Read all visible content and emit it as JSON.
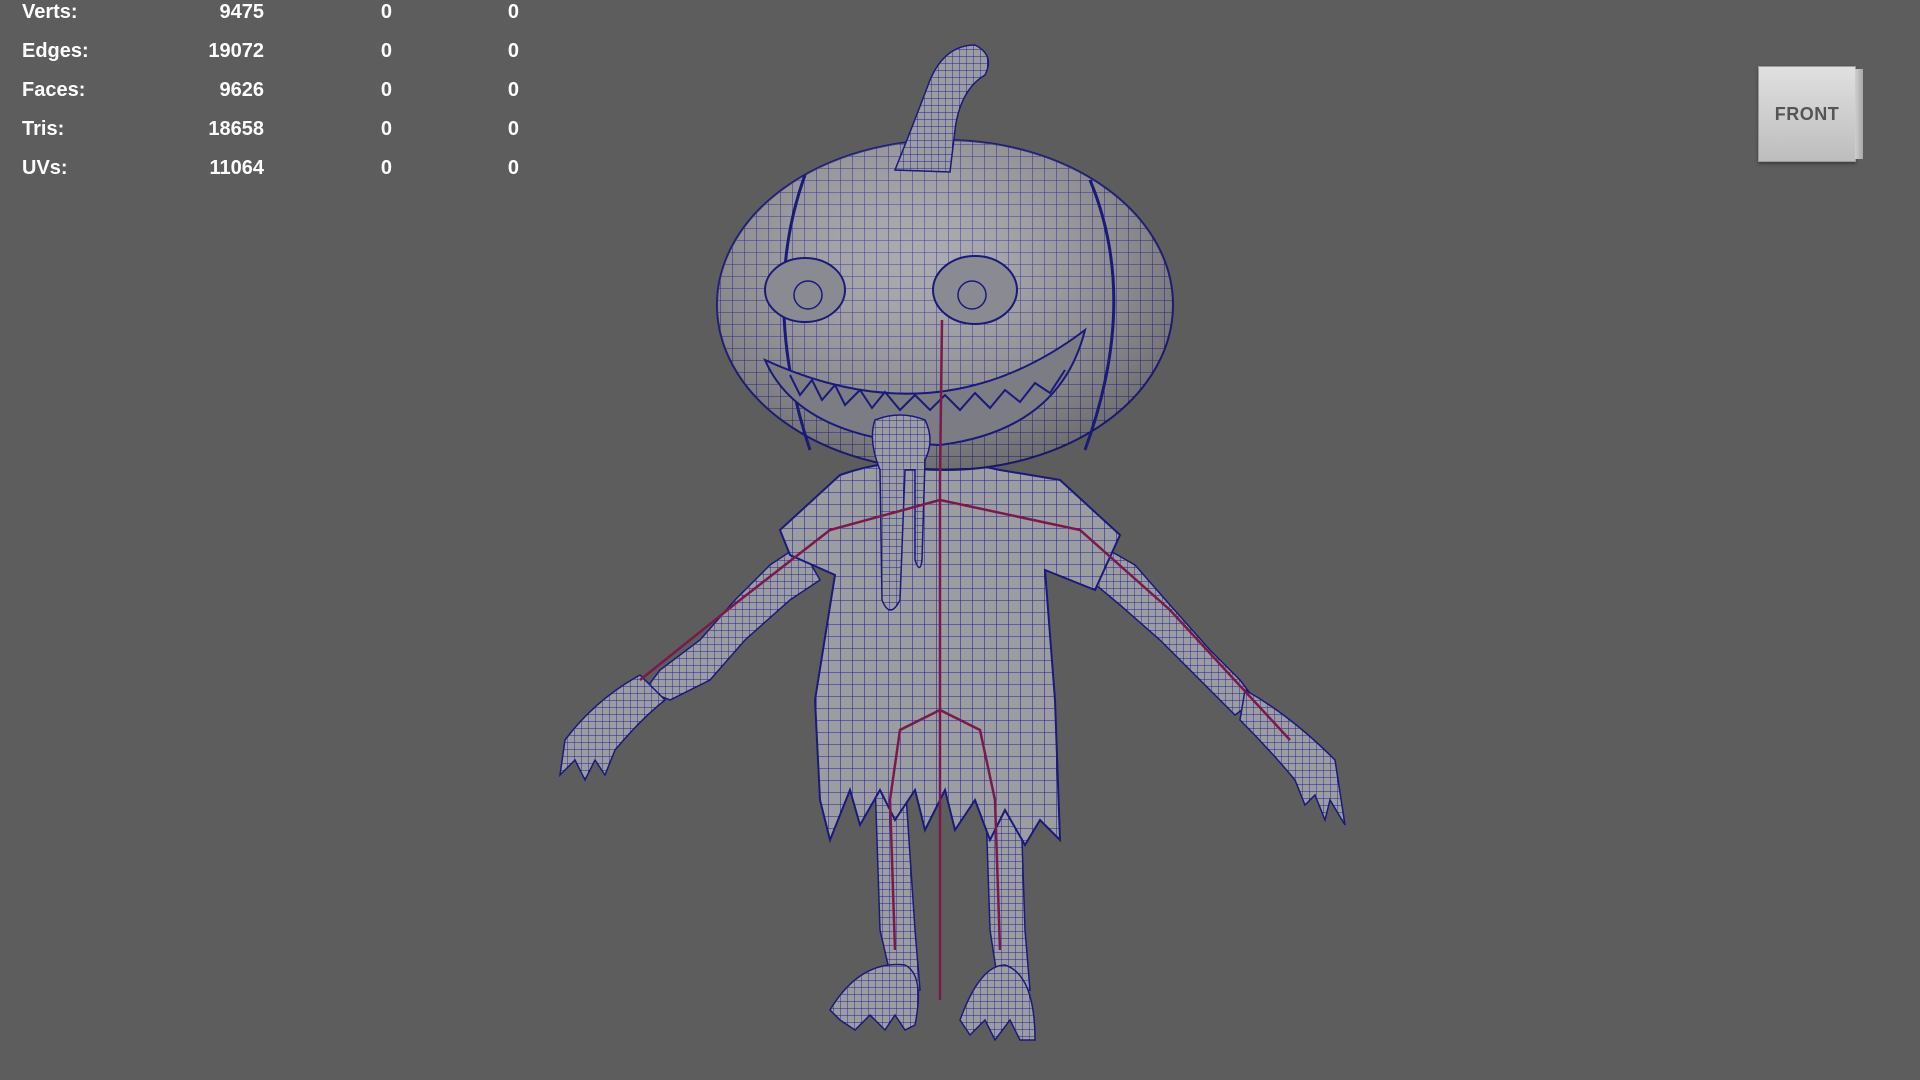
{
  "hud": {
    "rows": [
      {
        "label": "Verts:",
        "v1": "9475",
        "v2": "0",
        "v3": "0"
      },
      {
        "label": "Edges:",
        "v1": "19072",
        "v2": "0",
        "v3": "0"
      },
      {
        "label": "Faces:",
        "v1": "9626",
        "v2": "0",
        "v3": "0"
      },
      {
        "label": "Tris:",
        "v1": "18658",
        "v2": "0",
        "v3": "0"
      },
      {
        "label": "UVs:",
        "v1": "11064",
        "v2": "0",
        "v3": "0"
      }
    ]
  },
  "viewcube": {
    "label": "FRONT"
  },
  "colors": {
    "background": "#5d5d5d",
    "mesh_fill": "#9a9aa0",
    "wireframe": "#1e1e8c",
    "skeleton": "#7a1a4a"
  }
}
